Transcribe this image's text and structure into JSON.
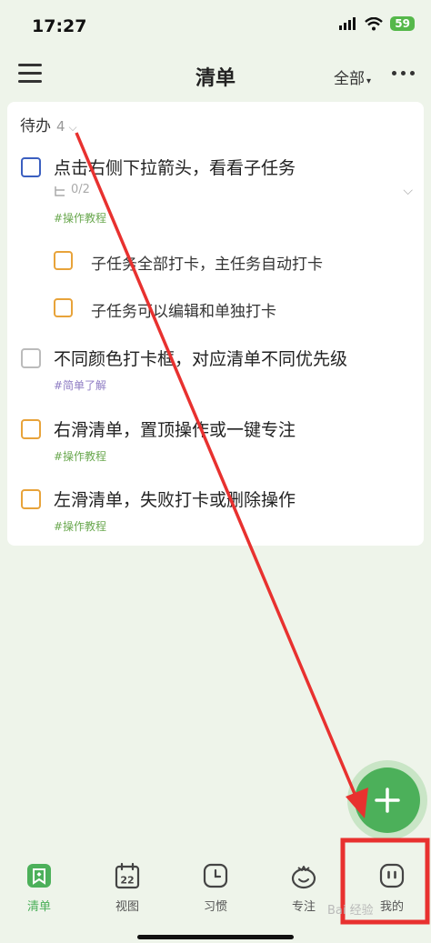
{
  "status_bar": {
    "time": "17:27",
    "battery": "59"
  },
  "header": {
    "title": "清单",
    "filter": "全部"
  },
  "section": {
    "title": "待办",
    "count": "4"
  },
  "tasks": [
    {
      "text": "点击右侧下拉箭头，看看子任务",
      "progress": "0/2",
      "tag": "#操作教程"
    },
    {
      "text": "子任务全部打卡，主任务自动打卡"
    },
    {
      "text": "子任务可以编辑和单独打卡"
    },
    {
      "text": "不同颜色打卡框，对应清单不同优先级",
      "tag": "#简单了解"
    },
    {
      "text": "右滑清单，置顶操作或一键专注",
      "tag": "#操作教程"
    },
    {
      "text": "左滑清单，失败打卡或删除操作",
      "tag": "#操作教程"
    }
  ],
  "colors": {
    "accent": "#4cb05a",
    "checkbox_blue": "#3b5fc0",
    "checkbox_orange": "#e8a33a",
    "checkbox_gray": "#bbbbbb",
    "tag_green": "#6aa84f",
    "tag_purple": "#8e7cc3",
    "annotation_red": "#e8312f"
  },
  "nav": {
    "items": [
      {
        "label": "清单",
        "icon": "list-icon"
      },
      {
        "label": "视图",
        "icon": "calendar-icon"
      },
      {
        "label": "习惯",
        "icon": "clock-icon"
      },
      {
        "label": "专注",
        "icon": "tomato-icon"
      },
      {
        "label": "我的",
        "icon": "profile-icon"
      }
    ],
    "calendar_day": "22"
  },
  "watermark": "Bai 经验"
}
